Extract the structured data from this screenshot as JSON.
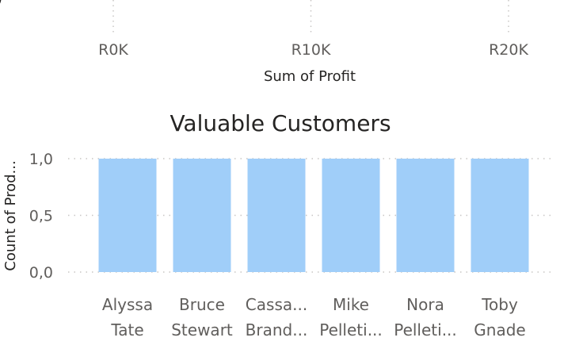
{
  "chart_data": [
    {
      "type": "bar",
      "orientation": "horizontal",
      "xlabel": "Sum of Profit",
      "x_ticks": [
        "R0K",
        "R10K",
        "R20K"
      ],
      "x_tick_values": [
        0,
        10000,
        20000
      ],
      "grid": true
    },
    {
      "type": "bar",
      "title": "Valuable Customers",
      "ylabel": "Count of Prod...",
      "y_ticks": [
        "1,0",
        "0,5",
        "0,0"
      ],
      "y_tick_values": [
        1.0,
        0.5,
        0.0
      ],
      "ylim": [
        0,
        1
      ],
      "grid": true,
      "categories": [
        [
          "Alyssa",
          "Tate"
        ],
        [
          "Bruce",
          "Stewart"
        ],
        [
          "Cassa...",
          "Brand..."
        ],
        [
          "Mike",
          "Pelleti..."
        ],
        [
          "Nora",
          "Pelleti..."
        ],
        [
          "Toby",
          "Gnade"
        ]
      ],
      "values": [
        1,
        1,
        1,
        1,
        1,
        1
      ],
      "bar_color": "#a0cef9"
    }
  ],
  "colors": {
    "grid": "#c8c6c4",
    "text": "#252423",
    "tick": "#605e5c"
  }
}
